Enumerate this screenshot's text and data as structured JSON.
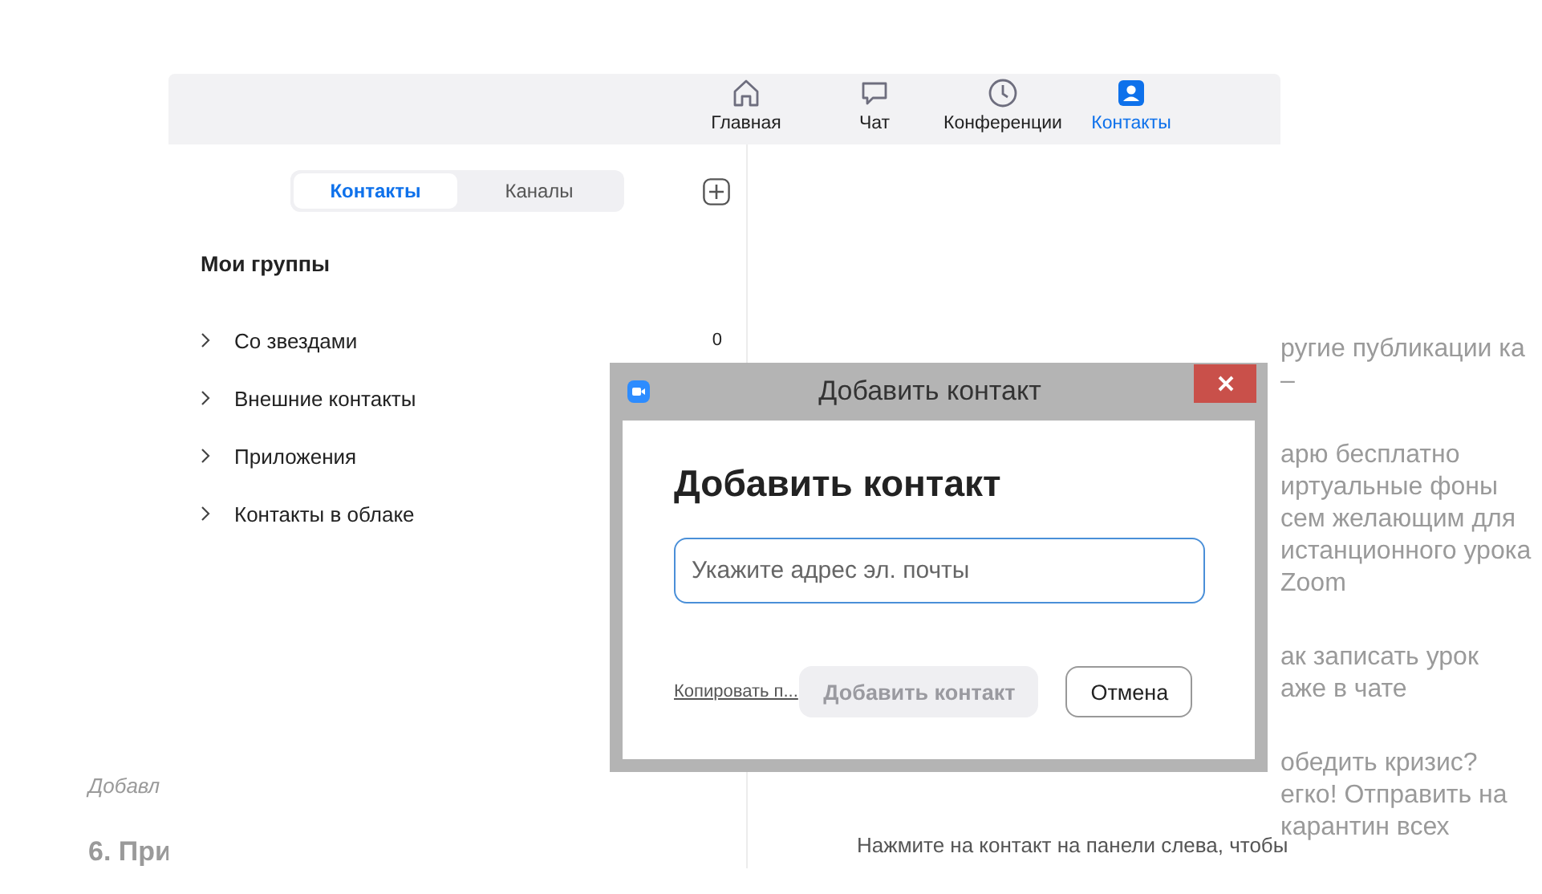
{
  "background_page": {
    "left_texts": [
      {
        "text": "Добавл",
        "kind": "caption"
      },
      {
        "text": "6. При",
        "kind": "heading"
      }
    ],
    "right_blocks": [
      {
        "lines": [
          "ругие публикации ка",
          "–"
        ]
      },
      {
        "lines": [
          "арю бесплатно",
          "иртуальные фоны",
          "сем желающим для",
          "истанционного урока",
          "Zoom"
        ]
      },
      {
        "lines": [
          "ак записать урок",
          "аже в чате"
        ]
      },
      {
        "lines": [
          "обедить кризис?",
          "егко! Отправить на",
          "карантин всех"
        ]
      }
    ]
  },
  "app": {
    "nav": [
      {
        "label": "Главная",
        "selected": false
      },
      {
        "label": "Чат",
        "selected": false
      },
      {
        "label": "Конференции",
        "selected": false
      },
      {
        "label": "Контакты",
        "selected": true
      }
    ],
    "segments": [
      {
        "label": "Контакты",
        "selected": true
      },
      {
        "label": "Каналы",
        "selected": false
      }
    ],
    "groups_title": "Мои группы",
    "groups": [
      {
        "label": "Со звездами",
        "count": "0"
      },
      {
        "label": "Внешние контакты"
      },
      {
        "label": "Приложения"
      },
      {
        "label": "Контакты в облаке"
      }
    ],
    "hint": "Нажмите на контакт на панели слева, чтобы"
  },
  "dialog": {
    "title": "Добавить контакт",
    "heading": "Добавить контакт",
    "email_placeholder": "Укажите адрес эл. почты",
    "copy_link": "Копировать п...",
    "add_button": {
      "label": "Добавить контакт",
      "disabled": true
    },
    "cancel_button": "Отмена"
  }
}
